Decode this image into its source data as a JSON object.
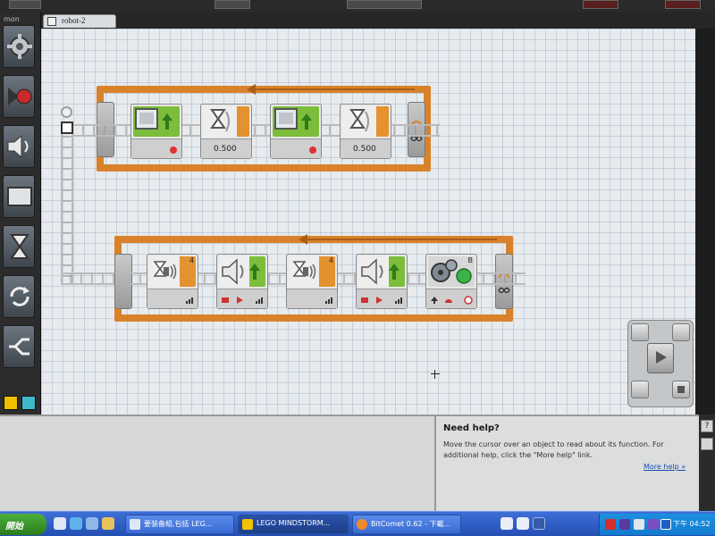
{
  "window": {
    "tab_label": "robot-2",
    "palette_label": "mon"
  },
  "palette": [
    {
      "name": "move",
      "icon": "gears-icon"
    },
    {
      "name": "record-play",
      "icon": "record-play-icon"
    },
    {
      "name": "sound",
      "icon": "speaker-icon"
    },
    {
      "name": "display",
      "icon": "display-icon"
    },
    {
      "name": "wait",
      "icon": "hourglass-icon"
    },
    {
      "name": "loop",
      "icon": "loop-icon"
    },
    {
      "name": "switch",
      "icon": "switch-icon"
    }
  ],
  "program": {
    "loop1": {
      "blocks": [
        {
          "type": "display",
          "value": ""
        },
        {
          "type": "wait-time",
          "value": "0.500"
        },
        {
          "type": "display",
          "value": ""
        },
        {
          "type": "wait-time",
          "value": "0.500"
        }
      ]
    },
    "loop2": {
      "blocks": [
        {
          "type": "wait-sound",
          "port": "4"
        },
        {
          "type": "sound",
          "port": ""
        },
        {
          "type": "wait-sound",
          "port": "4"
        },
        {
          "type": "sound",
          "port": ""
        },
        {
          "type": "motor",
          "port": "B"
        }
      ]
    }
  },
  "help": {
    "title": "Need help?",
    "text": "Move the cursor over an object to read about its function. For additional help, click the \"More help\" link.",
    "link": "More help »"
  },
  "taskbar": {
    "start": "開始",
    "tasks": [
      {
        "label": "要装备組,包括 LEG..."
      },
      {
        "label": "LEGO MINDSTORM..."
      },
      {
        "label": "BitComet 0.62 - 下載..."
      }
    ],
    "clock": "下午 04:52"
  },
  "colors": {
    "loop": "#d9822b",
    "green": "#7dbd3c",
    "orange": "#e3922f",
    "taskbar": "#3d6fd8"
  }
}
